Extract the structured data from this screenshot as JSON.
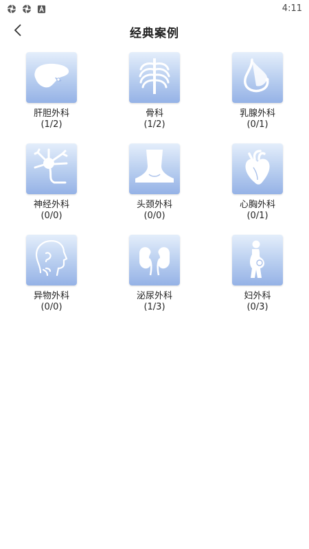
{
  "status_bar": {
    "time": "4:11",
    "icons": [
      "aperture-icon",
      "aperture-icon",
      "notification-a-icon"
    ]
  },
  "header": {
    "title": "经典案例",
    "back_icon": "chevron-left-icon"
  },
  "cases": [
    {
      "name": "肝胆外科",
      "count": "(1/2)",
      "icon": "liver-icon"
    },
    {
      "name": "骨科",
      "count": "(1/2)",
      "icon": "ribcage-icon"
    },
    {
      "name": "乳腺外科",
      "count": "(0/1)",
      "icon": "breast-icon"
    },
    {
      "name": "神经外科",
      "count": "(0/0)",
      "icon": "neuron-icon"
    },
    {
      "name": "头颈外科",
      "count": "(0/0)",
      "icon": "neck-icon"
    },
    {
      "name": "心胸外科",
      "count": "(0/1)",
      "icon": "heart-icon"
    },
    {
      "name": "异物外科",
      "count": "(0/0)",
      "icon": "head-profile-icon"
    },
    {
      "name": "泌尿外科",
      "count": "(1/3)",
      "icon": "kidneys-icon"
    },
    {
      "name": "妇外科",
      "count": "(0/3)",
      "icon": "pregnant-woman-icon"
    }
  ],
  "colors": {
    "tile_top": "#e4eefb",
    "tile_bottom": "#95b2e6",
    "icon_fill": "#ffffff"
  }
}
